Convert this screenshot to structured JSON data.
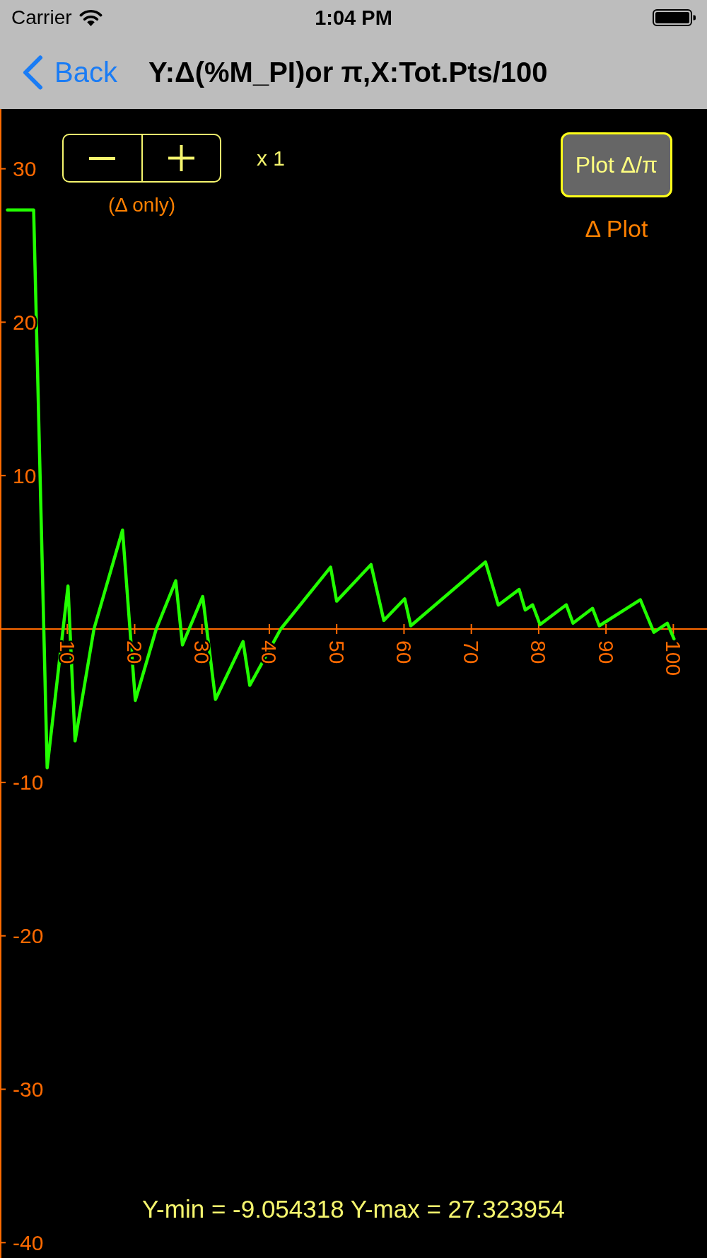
{
  "status_bar": {
    "carrier": "Carrier",
    "time": "1:04 PM"
  },
  "nav_bar": {
    "back_label": "Back",
    "title": "Y:Δ(%M_PI)or π,X:Tot.Pts/100"
  },
  "plot": {
    "stepper_note": "(Δ only)",
    "scale": "x 1",
    "toggle_button": "Plot Δ/π",
    "mode": "Δ Plot",
    "range_text": "Y-min = -9.054318 Y-max = 27.323954",
    "chart_data": {
      "type": "line",
      "xlim": [
        0,
        105
      ],
      "ylim": [
        -41,
        33.9
      ],
      "xticks": [
        10,
        20,
        30,
        40,
        50,
        60,
        70,
        80,
        90,
        100
      ],
      "yticks": [
        30,
        20,
        10,
        -10,
        -20,
        -30,
        -40
      ],
      "x": [
        1.1,
        5.0,
        7.0,
        10.1,
        11.15,
        13.95,
        18.2,
        20.1,
        23.2,
        26.1,
        27.1,
        30.1,
        32.0,
        36.1,
        37.1,
        41.7,
        49.1,
        50.0,
        55.1,
        57.0,
        60.1,
        61.0,
        72.1,
        74.0,
        77.1,
        78.0,
        79.1,
        80.2,
        84.1,
        85.1,
        88.0,
        89.0,
        95.1,
        97.1,
        99.1,
        100.1
      ],
      "series": [
        {
          "color": "#22ff00",
          "values": [
            27.32,
            27.32,
            -9.05,
            2.8,
            -7.3,
            0,
            6.45,
            -4.65,
            0,
            3.14,
            -1.03,
            2.12,
            -4.59,
            -0.82,
            -3.67,
            0,
            4.03,
            1.82,
            4.2,
            0.56,
            1.97,
            0.21,
            4.37,
            1.56,
            2.58,
            1.24,
            1.58,
            0.29,
            1.58,
            0.38,
            1.35,
            0.21,
            1.91,
            -0.21,
            0.38,
            -0.64
          ]
        }
      ]
    }
  }
}
